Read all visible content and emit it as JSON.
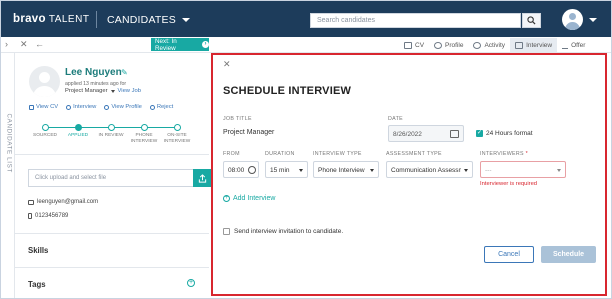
{
  "topbar": {
    "logo": "bravo",
    "logo_suffix": "TALENT",
    "module": "CANDIDATES",
    "search_placeholder": "Search candidates"
  },
  "subbar": {
    "next_button": "Next: In Review",
    "tabs": [
      {
        "label": "CV",
        "icon": "cv-icon"
      },
      {
        "label": "Profile",
        "icon": "profile-icon"
      },
      {
        "label": "Activity",
        "icon": "activity-icon"
      },
      {
        "label": "Interview",
        "icon": "interview-icon",
        "active": true
      },
      {
        "label": "Offer",
        "icon": "offer-icon"
      }
    ]
  },
  "sidebar": {
    "vertical_label": "CANDIDATE LIST"
  },
  "candidate": {
    "name": "Lee Nguyen",
    "applied": "applied 13 minutes ago for",
    "job": "Project Manager",
    "view_job": "View Job",
    "actions": [
      "View CV",
      "Interview",
      "View Profile",
      "Reject"
    ],
    "stages": [
      "SOURCED",
      "APPLIED",
      "IN REVIEW",
      "PHONE INTERVIEW",
      "ON-SITE INTERVIEW"
    ],
    "current_stage_index": 1,
    "upload_placeholder": "Click upload and select file",
    "email": "leenguyen@gmail.com",
    "phone": "0123456789",
    "sections": [
      "Skills",
      "Tags"
    ]
  },
  "modal": {
    "title": "SCHEDULE INTERVIEW",
    "job_title_label": "JOB TITLE",
    "job_title": "Project Manager",
    "date_label": "DATE",
    "date": "8/26/2022",
    "hours_format_label": "24 Hours format",
    "hours_format_checked": true,
    "from_label": "FROM",
    "from_value": "08:00",
    "duration_label": "DURATION",
    "duration_value": "15 min",
    "interview_type_label": "INTERVIEW TYPE",
    "interview_type_value": "Phone Interview",
    "assessment_type_label": "ASSESSMENT TYPE",
    "assessment_type_value": "Communication Assessment",
    "interviewers_label": "INTERVIEWERS",
    "interviewers_required_mark": "*",
    "interviewers_placeholder": "---",
    "interviewers_error": "Interviewer is required",
    "add_interview": "Add Interview",
    "send_invitation_label": "Send interview invitation to candidate.",
    "send_invitation_checked": false,
    "cancel": "Cancel",
    "schedule": "Schedule"
  },
  "colors": {
    "navbar": "#1d3c5b",
    "accent": "#18a9a3",
    "highlight_border": "#d8262f",
    "link": "#3b77b8"
  }
}
